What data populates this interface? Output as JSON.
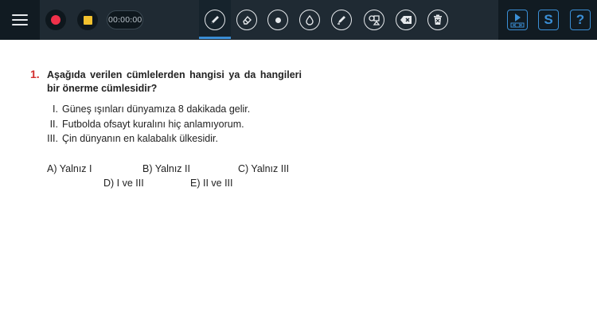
{
  "toolbar": {
    "timer": "00:00:00",
    "icons": {
      "menu": "hamburger-menu-icon",
      "record": "record-icon",
      "stop": "stop-icon",
      "pen": "pen-icon",
      "eraser": "eraser-icon",
      "dot": "dot-size-icon",
      "color": "color-drop-icon",
      "highlighter": "highlighter-icon",
      "shapes": "shapes-icon",
      "clear": "backspace-clear-icon",
      "delete": "trash-icon",
      "player": "media-player-icon",
      "s_button": "S",
      "help": "?"
    },
    "colors": {
      "bar": "#1f2a33",
      "record": "#f0314a",
      "stop": "#f2c12e",
      "accent": "#3b8fd6"
    }
  },
  "question": {
    "number": "1.",
    "text_line1": "Aşağıda verilen cümlelerden hangisi ya da hangileri",
    "text_line2": "bir önerme cümlesidir?",
    "statements": [
      {
        "roman": "I.",
        "text": "Güneş ışınları dünyamıza 8 dakikada gelir."
      },
      {
        "roman": "II.",
        "text": "Futbolda ofsayt kuralını hiç anlamıyorum."
      },
      {
        "roman": "III.",
        "text": "Çin dünyanın en kalabalık ülkesidir."
      }
    ],
    "options": {
      "a": "A) Yalnız I",
      "b": "B) Yalnız II",
      "c": "C) Yalnız III",
      "d": "D) I ve III",
      "e": "E) II ve III"
    }
  }
}
